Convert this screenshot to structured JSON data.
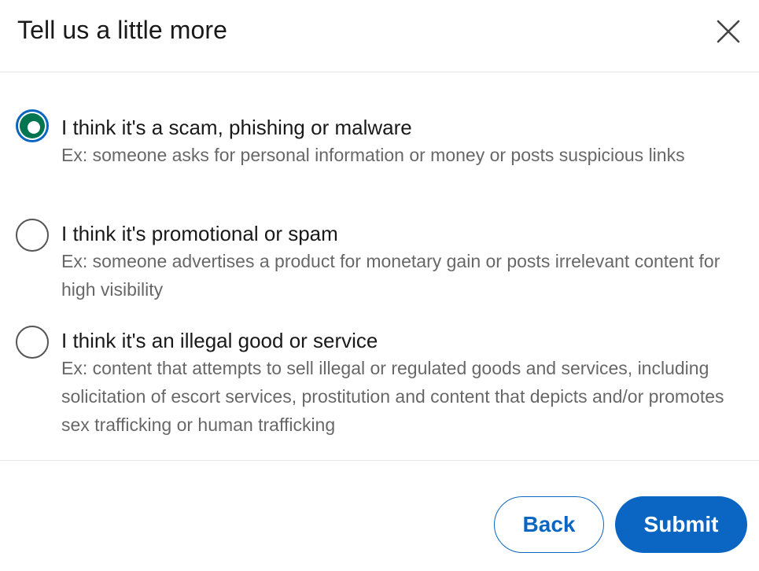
{
  "dialog": {
    "title": "Tell us a little more",
    "close_icon": "close-icon"
  },
  "options": [
    {
      "label": "I think it's a scam, phishing or malware",
      "description": "Ex: someone asks for personal information or money or posts suspicious links",
      "selected": true
    },
    {
      "label": "I think it's promotional or spam",
      "description": "Ex: someone advertises a product for monetary gain or posts irrelevant content for high visibility",
      "selected": false
    },
    {
      "label": "I think it's an illegal good or service",
      "description": "Ex: content that attempts to sell illegal or regulated goods and services, including solicitation of escort services, prostitution and content that depicts and/or promotes sex trafficking or human trafficking",
      "selected": false
    }
  ],
  "footer": {
    "back_label": "Back",
    "submit_label": "Submit"
  },
  "colors": {
    "primary": "#0a66c2",
    "selected_radio": "#01754f",
    "text": "#191919",
    "muted_text": "#666666"
  }
}
